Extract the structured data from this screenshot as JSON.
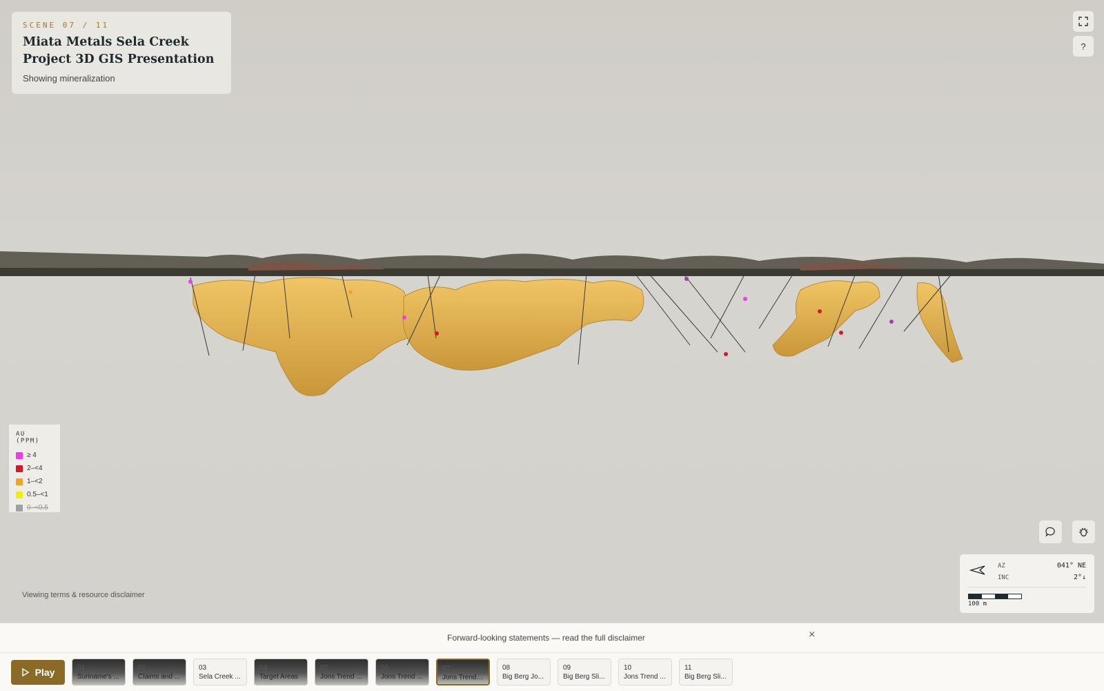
{
  "header": {
    "scene_tag": "SCENE 07 / 11",
    "title": "Miata Metals Sela Creek Project 3D GIS Presentation",
    "subtitle": "Showing mineralization"
  },
  "top_controls": {
    "fullscreen_icon": "fullscreen-icon",
    "help_label": "?"
  },
  "legend": {
    "title": "AU (PPM)",
    "items": [
      {
        "label": "≥ 4",
        "color": "#f03ce8"
      },
      {
        "label": "2–<4",
        "color": "#d6182b"
      },
      {
        "label": "1–<2",
        "color": "#f5a31f"
      },
      {
        "label": "0.5–<1",
        "color": "#f3ec12"
      },
      {
        "label": "0–<0.5",
        "color": "#9aa3a6",
        "disabled": true
      }
    ]
  },
  "terms_link": "Viewing terms & resource disclaimer",
  "tools": {
    "comment_icon": "comment-icon",
    "bug_icon": "bug-icon"
  },
  "compass": {
    "az_label": "AZ",
    "az_value": "041° NE",
    "inc_label": "INC",
    "inc_value": "2°↓",
    "scale_label": "100 m"
  },
  "disclaimer": {
    "text": "Forward-looking statements — read the full disclaimer",
    "close": "×"
  },
  "player": {
    "play_label": "Play",
    "scenes": [
      {
        "num": "01",
        "label": "Suriname's ...",
        "style": "dark"
      },
      {
        "num": "02",
        "label": "Claims and ...",
        "style": "dark"
      },
      {
        "num": "03",
        "label": "Sela Creek ...",
        "style": "light"
      },
      {
        "num": "04",
        "label": "Target Areas",
        "style": "dark"
      },
      {
        "num": "05",
        "label": "Jons Trend ...",
        "style": "dark"
      },
      {
        "num": "06",
        "label": "Jons Trend ...",
        "style": "dark"
      },
      {
        "num": "07",
        "label": "Jons Trend ...",
        "style": "dark",
        "active": true
      },
      {
        "num": "08",
        "label": "Big Berg Jo...",
        "style": "light"
      },
      {
        "num": "09",
        "label": "Big Berg Sli...",
        "style": "light"
      },
      {
        "num": "10",
        "label": "Jons Trend ...",
        "style": "light"
      },
      {
        "num": "11",
        "label": "Big Berg Sli...",
        "style": "light"
      }
    ]
  }
}
